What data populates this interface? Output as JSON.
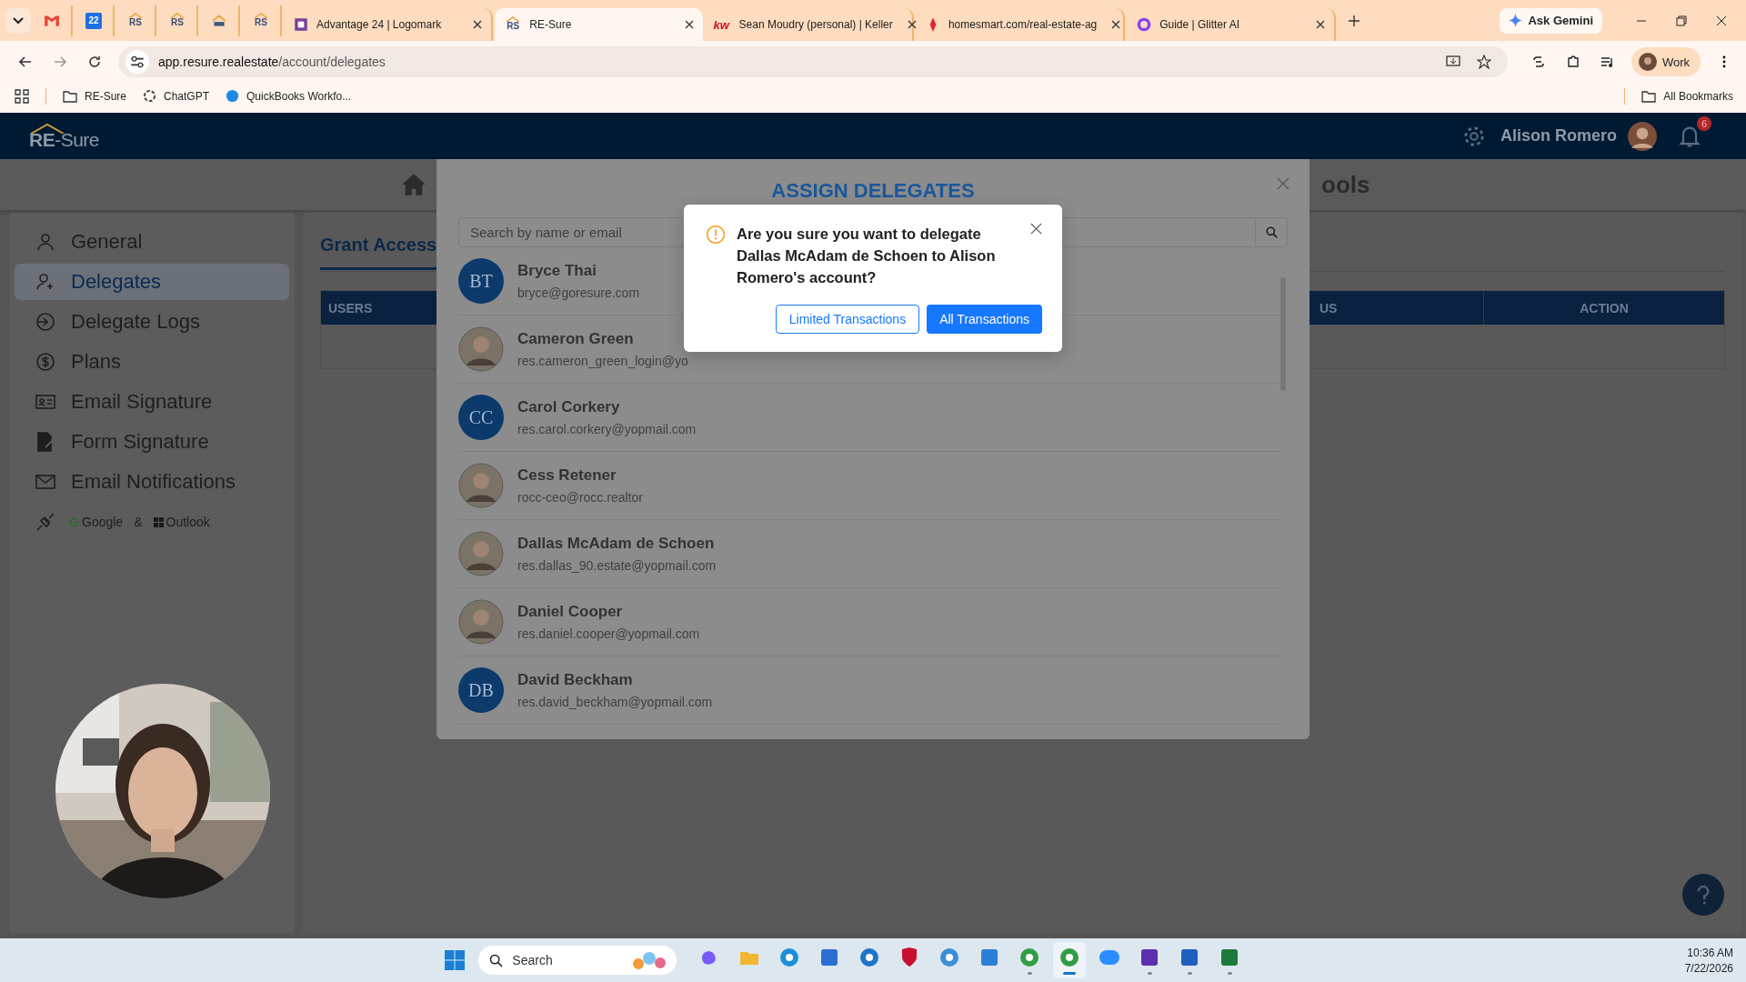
{
  "browser": {
    "pinned_tabs": [
      {
        "selected": false
      },
      {
        "selected": false,
        "icon_text": "22"
      },
      {
        "selected": false,
        "icon_text": "RS"
      },
      {
        "selected": false,
        "icon_text": "RS"
      },
      {
        "selected": false
      },
      {
        "selected": false,
        "icon_text": "RS"
      }
    ],
    "tabs": [
      {
        "title": "Advantage 24 | Logomark",
        "selected": false
      },
      {
        "title": "RE-Sure",
        "icon_text": "RS",
        "selected": true
      },
      {
        "title": "Sean Moudry (personal) | Keller",
        "icon_text": "kw",
        "selected": false
      },
      {
        "title": "homesmart.com/real-estate-ag",
        "selected": false
      },
      {
        "title": "Guide | Glitter AI",
        "selected": false
      }
    ],
    "gemini_button": "Ask Gemini",
    "address": {
      "host": "app.resure.realestate",
      "path": "/account/delegates"
    },
    "profile": "Work",
    "bookmarks": [
      "RE-Sure",
      "ChatGPT",
      "QuickBooks Workfo..."
    ],
    "all_bookmarks": "All Bookmarks"
  },
  "app": {
    "logo": "**RE**-Sure",
    "user": "Alison Romero",
    "notifications": "6",
    "page_title": "ools",
    "sidebar": [
      {
        "label": "General",
        "selected": false
      },
      {
        "label": "Delegates",
        "selected": true
      },
      {
        "label": "Delegate Logs",
        "selected": false
      },
      {
        "label": "Plans",
        "selected": false
      },
      {
        "label": "Email Signature",
        "selected": false
      },
      {
        "label": "Form Signature",
        "selected": false
      },
      {
        "label": "Email Notifications",
        "selected": false
      }
    ],
    "integration": {
      "google": "Google",
      "separator": "&",
      "outlook": "Outlook"
    },
    "section_tab": "Grant Access",
    "table_columns": [
      "USERS",
      "US",
      "ACTION"
    ]
  },
  "modal": {
    "title": "ASSIGN DELEGATES",
    "search_placeholder": "Search by name or email",
    "users": [
      {
        "name": "Bryce Thai",
        "email": "bryce@goresure.com",
        "kind": "initials",
        "initials": "BT"
      },
      {
        "name": "Cameron Green",
        "email": "res.cameron_green_login@yo"
      },
      {
        "name": "Carol Corkery",
        "email": "res.carol.corkery@yopmail.com",
        "kind": "initials",
        "initials": "CC"
      },
      {
        "name": "Cess Retener",
        "email": "rocc-ceo@rocc.realtor"
      },
      {
        "name": "Dallas McAdam de Schoen",
        "email": "res.dallas_90.estate@yopmail.com"
      },
      {
        "name": "Daniel Cooper",
        "email": "res.daniel.cooper@yopmail.com"
      },
      {
        "name": "David Beckham",
        "email": "res.david_beckham@yopmail.com",
        "kind": "initials",
        "initials": "DB"
      }
    ]
  },
  "confirm": {
    "message": "Are you sure you want to delegate Dallas McAdam de Schoen to Alison Romero's account?",
    "buttons": [
      {
        "label": "Limited Transactions",
        "kind": "outline"
      },
      {
        "label": "All Transactions",
        "kind": "primary"
      }
    ]
  },
  "taskbar": {
    "search_placeholder": "Search",
    "apps": [
      {
        "running": false,
        "selected": false
      },
      {
        "running": false,
        "selected": false
      },
      {
        "running": false,
        "selected": false
      },
      {
        "running": false,
        "selected": false
      },
      {
        "running": false,
        "selected": false
      },
      {
        "running": false,
        "selected": false
      },
      {
        "running": false,
        "selected": false
      },
      {
        "running": false,
        "selected": false
      },
      {
        "running": true,
        "selected": false
      },
      {
        "running": true,
        "selected": true
      },
      {
        "running": false,
        "selected": false
      },
      {
        "running": true,
        "selected": false
      },
      {
        "running": true,
        "selected": false
      },
      {
        "running": true,
        "selected": false
      }
    ],
    "time": "10:36 AM",
    "date": "7/22/2026"
  }
}
